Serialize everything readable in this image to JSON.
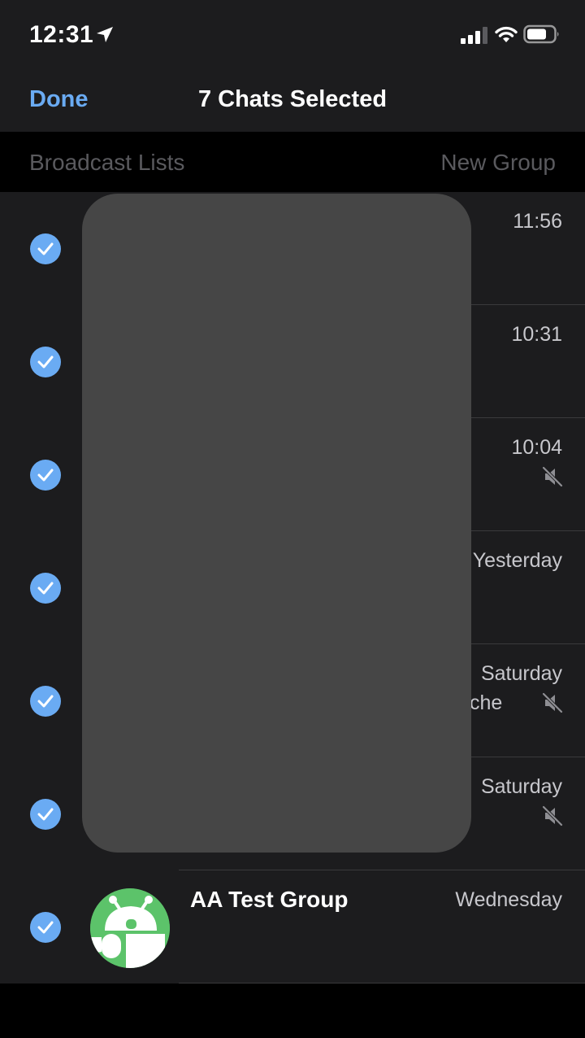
{
  "status_bar": {
    "time": "12:31",
    "icons": [
      "location-arrow-icon",
      "cellular-signal-icon",
      "wifi-icon",
      "battery-icon"
    ]
  },
  "nav": {
    "done_label": "Done",
    "title": "7 Chats Selected"
  },
  "subnav": {
    "broadcast_label": "Broadcast Lists",
    "new_group_label": "New Group"
  },
  "chats": [
    {
      "time": "11:56",
      "selected": true,
      "muted": false
    },
    {
      "time": "10:31",
      "selected": true,
      "muted": false
    },
    {
      "time": "10:04",
      "selected": true,
      "muted": true
    },
    {
      "time": "Yesterday",
      "selected": true,
      "muted": false
    },
    {
      "time": "Saturday",
      "selected": true,
      "muted": true,
      "preview_fragment": "che"
    },
    {
      "time": "Saturday",
      "selected": true,
      "muted": true
    },
    {
      "time": "Wednesday",
      "selected": true,
      "muted": false,
      "name": "AA Test Group",
      "avatar": "android-robot-avatar"
    }
  ],
  "colors": {
    "accent": "#6aabf3",
    "background": "#1c1c1e",
    "redaction": "#464646",
    "avatar_green": "#5cc36a"
  }
}
